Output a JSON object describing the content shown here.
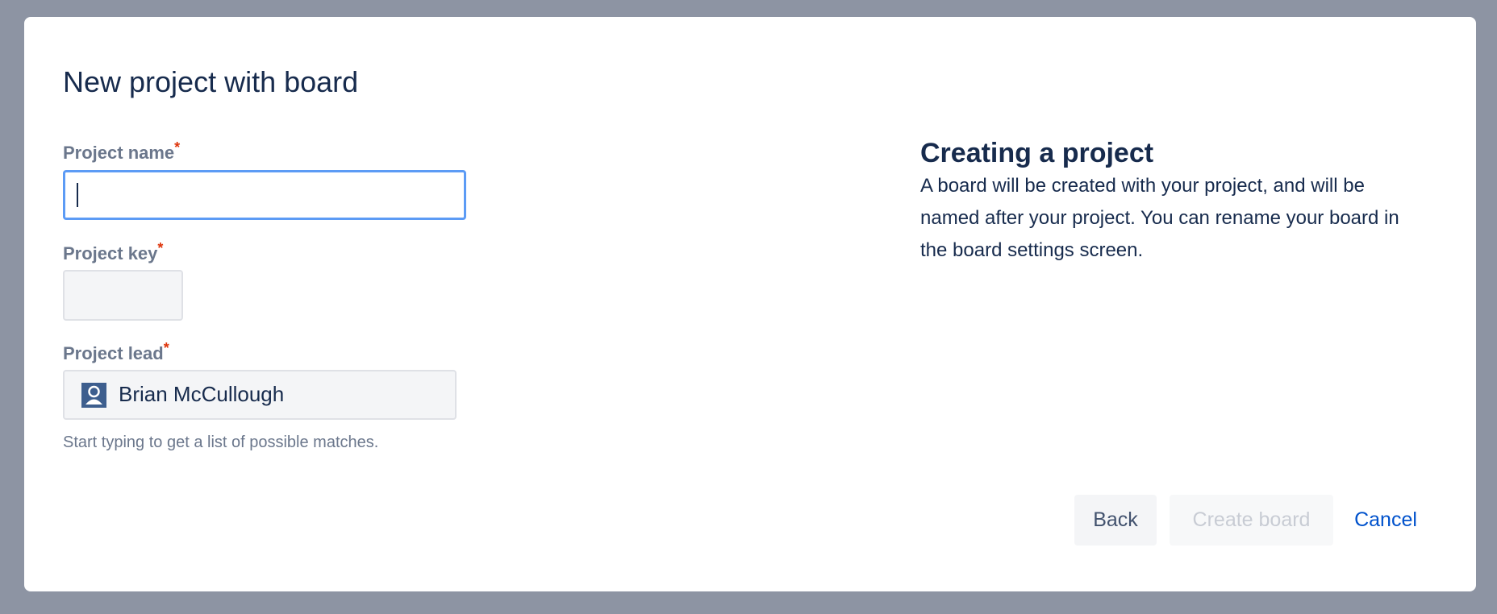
{
  "dialog": {
    "title": "New project with board",
    "fields": {
      "project_name": {
        "label": "Project name",
        "required_mark": "*",
        "value": ""
      },
      "project_key": {
        "label": "Project key",
        "required_mark": "*",
        "value": ""
      },
      "project_lead": {
        "label": "Project lead",
        "required_mark": "*",
        "value": "Brian McCullough",
        "icon": "user-avatar-icon",
        "helper": "Start typing to get a list of possible matches."
      }
    },
    "info": {
      "heading": "Creating a project",
      "body": "A board will be created with your project, and will be named after your project. You can rename your board in the board settings screen."
    },
    "buttons": {
      "back": "Back",
      "create": "Create board",
      "cancel": "Cancel"
    }
  },
  "colors": {
    "overlay": "#8d94a3",
    "focus": "#5c9bf5",
    "link": "#0052cc",
    "required": "#de350b"
  }
}
